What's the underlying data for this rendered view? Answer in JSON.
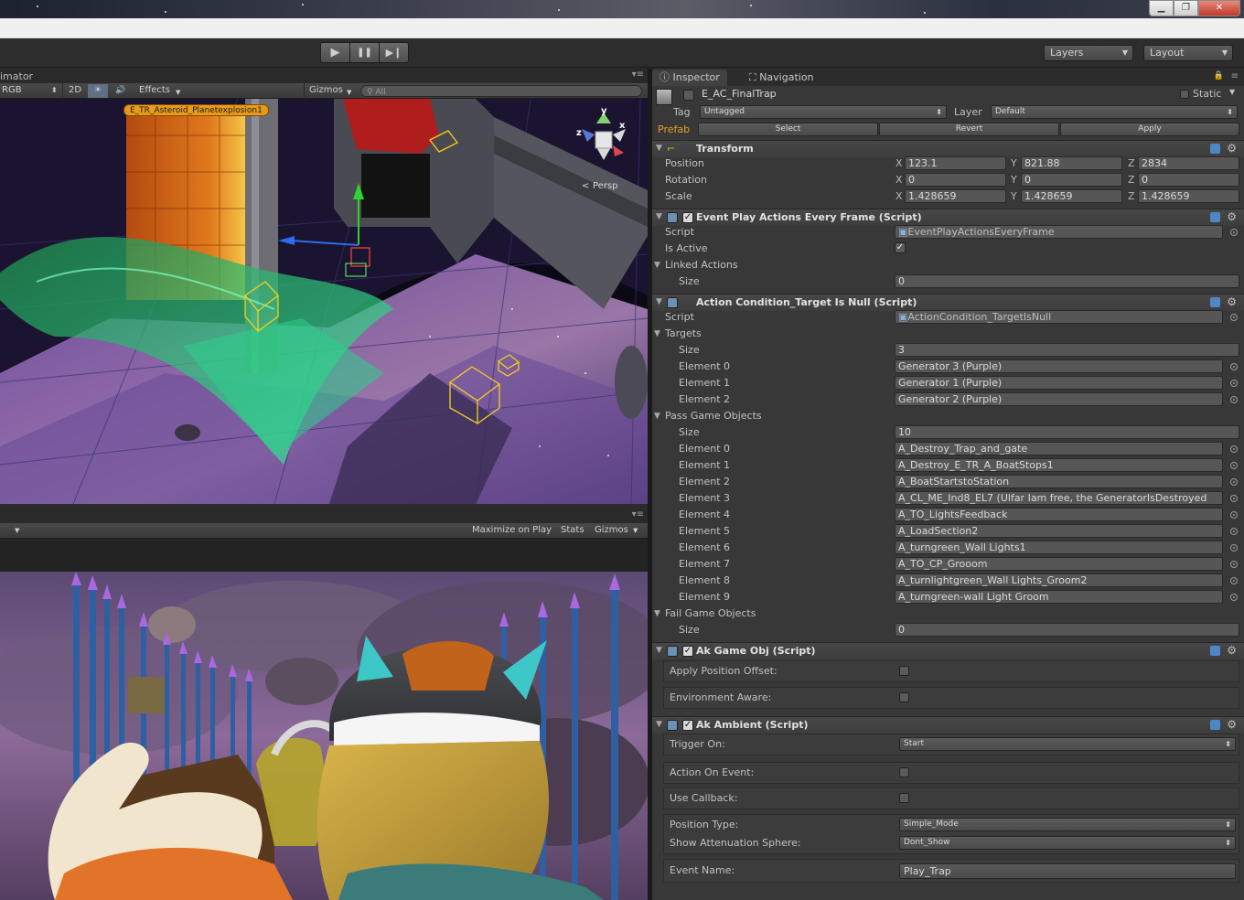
{
  "window": {
    "minimize_glyph": "▁",
    "restore_glyph": "❐",
    "close_glyph": "✕"
  },
  "toolbar": {
    "play_glyph": "▶",
    "pause_glyph": "❚❚",
    "step_glyph": "▶❙",
    "layers_label": "Layers",
    "layout_label": "Layout"
  },
  "scene": {
    "tab_label": "imator",
    "shading_mode": "RGB",
    "mode_2d": "2D",
    "light_glyph": "☀",
    "audio_glyph": "🔊",
    "effects_label": "Effects",
    "gizmos_label": "Gizmos",
    "search_placeholder": "All",
    "selected_label": "E_TR_Asteroid_Planetexplosion1",
    "persp_label": "Persp",
    "axis_x": "x",
    "axis_y": "y",
    "axis_z": "z"
  },
  "game": {
    "maximize_label": "Maximize on Play",
    "stats_label": "Stats",
    "gizmos_label": "Gizmos"
  },
  "inspector": {
    "tabs": {
      "inspector": "Inspector",
      "navigation": "Navigation"
    },
    "object_name": "E_AC_FinalTrap",
    "static_label": "Static",
    "tag_label": "Tag",
    "tag_value": "Untagged",
    "layer_label": "Layer",
    "layer_value": "Default",
    "prefab_label": "Prefab",
    "prefab_select": "Select",
    "prefab_revert": "Revert",
    "prefab_apply": "Apply",
    "transform": {
      "title": "Transform",
      "position_label": "Position",
      "rotation_label": "Rotation",
      "scale_label": "Scale",
      "position": {
        "x": "123.1",
        "y": "821.88",
        "z": "2834"
      },
      "rotation": {
        "x": "0",
        "y": "0",
        "z": "0"
      },
      "scale": {
        "x": "1.428659",
        "y": "1.428659",
        "z": "1.428659"
      }
    },
    "event_play": {
      "title": "Event Play Actions Every Frame (Script)",
      "script_label": "Script",
      "script_value": "EventPlayActionsEveryFrame",
      "is_active_label": "Is Active",
      "linked_label": "Linked Actions",
      "size_label": "Size",
      "size_value": "0"
    },
    "action_condition": {
      "title": "Action Condition_Target Is Null (Script)",
      "script_label": "Script",
      "script_value": "ActionCondition_TargetIsNull",
      "targets_label": "Targets",
      "targets_size_label": "Size",
      "targets_size_value": "3",
      "targets": [
        {
          "label": "Element 0",
          "value": "Generator 3 (Purple)"
        },
        {
          "label": "Element 1",
          "value": "Generator 1 (Purple)"
        },
        {
          "label": "Element 2",
          "value": "Generator 2 (Purple)"
        }
      ],
      "pass_label": "Pass Game Objects",
      "pass_size_label": "Size",
      "pass_size_value": "10",
      "pass": [
        {
          "label": "Element 0",
          "value": "A_Destroy_Trap_and_gate"
        },
        {
          "label": "Element 1",
          "value": "A_Destroy_E_TR_A_BoatStops1"
        },
        {
          "label": "Element 2",
          "value": "A_BoatStartstoStation"
        },
        {
          "label": "Element 3",
          "value": "A_CL_ME_Ind8_EL7 (Ulfar Iam free, the GeneratorIsDestroyed"
        },
        {
          "label": "Element 4",
          "value": "A_TO_LightsFeedback"
        },
        {
          "label": "Element 5",
          "value": "A_LoadSection2"
        },
        {
          "label": "Element 6",
          "value": "A_turngreen_Wall Lights1"
        },
        {
          "label": "Element 7",
          "value": "A_TO_CP_Grooom"
        },
        {
          "label": "Element 8",
          "value": "A_turnlightgreen_Wall Lights_Groom2"
        },
        {
          "label": "Element 9",
          "value": "A_turngreen-wall Light Groom"
        }
      ],
      "fail_label": "Fail Game Objects",
      "fail_size_label": "Size",
      "fail_size_value": "0"
    },
    "ak_game_obj": {
      "title": "Ak Game Obj (Script)",
      "apply_offset_label": "Apply Position Offset:",
      "env_aware_label": "Environment Aware:"
    },
    "ak_ambient": {
      "title": "Ak Ambient (Script)",
      "trigger_label": "Trigger On:",
      "trigger_value": "Start",
      "action_on_event_label": "Action On Event:",
      "use_callback_label": "Use Callback:",
      "position_type_label": "Position Type:",
      "position_type_value": "Simple_Mode",
      "attenuation_label": "Show Attenuation Sphere:",
      "attenuation_value": "Dont_Show",
      "event_name_label": "Event Name:",
      "event_name_value": "Play_Trap"
    }
  }
}
